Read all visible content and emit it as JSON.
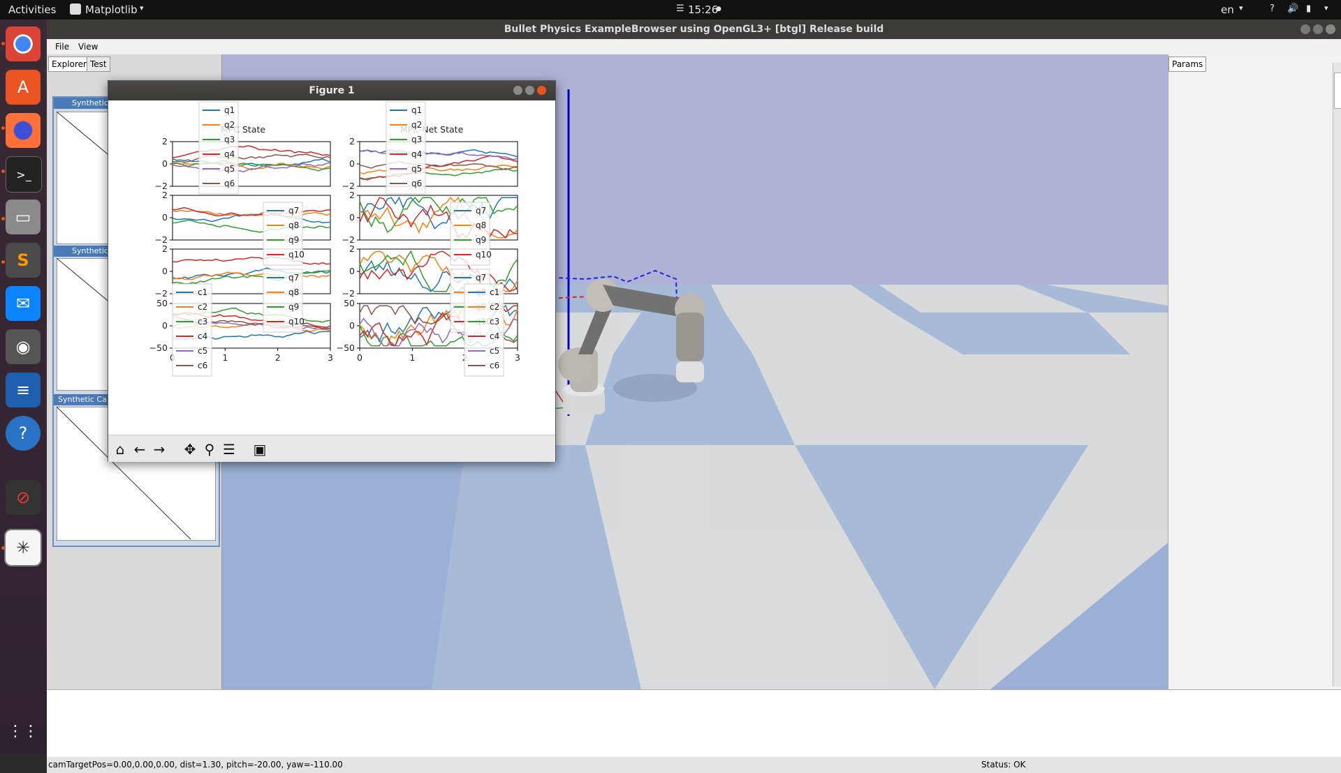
{
  "topbar": {
    "activities": "Activities",
    "app_name": "Matplotlib",
    "clock": "15:26",
    "lang": "en",
    "help": "?"
  },
  "window": {
    "title": "Bullet Physics ExampleBrowser using OpenGL3+ [btgl] Release build"
  },
  "menu": {
    "file": "File",
    "view": "View"
  },
  "explorer": {
    "tabs": [
      "Explorer",
      "Test"
    ],
    "cameras": [
      "Synthetic",
      "Synthetic",
      "Synthetic Ca"
    ]
  },
  "params": {
    "tab": "Params"
  },
  "status": {
    "left": "camTargetPos=0.00,0.00,0.00, dist=1.30, pitch=-20.00, yaw=-110.00",
    "right": "Status: OK"
  },
  "figure": {
    "title": "Figure 1",
    "titles": [
      "MPC State",
      "MPC-Net State"
    ],
    "legends": {
      "top": [
        "q1",
        "q2",
        "q3",
        "q4",
        "q5",
        "q6"
      ],
      "mid": [
        "q7",
        "q8",
        "q9",
        "q10"
      ],
      "ctrl": [
        "c1",
        "c2",
        "c3",
        "c4",
        "c5",
        "c6"
      ]
    },
    "colors": {
      "c1": "#1f77b4",
      "c2": "#ff7f0e",
      "c3": "#2ca02c",
      "c4": "#d62728",
      "c5": "#9467bd",
      "c6": "#8c564b"
    },
    "yticks_state": [
      "2",
      "0",
      "−2"
    ],
    "yticks_ctrl": [
      "50",
      "0",
      "−50"
    ],
    "xticks": [
      "0",
      "1",
      "2",
      "3"
    ]
  }
}
